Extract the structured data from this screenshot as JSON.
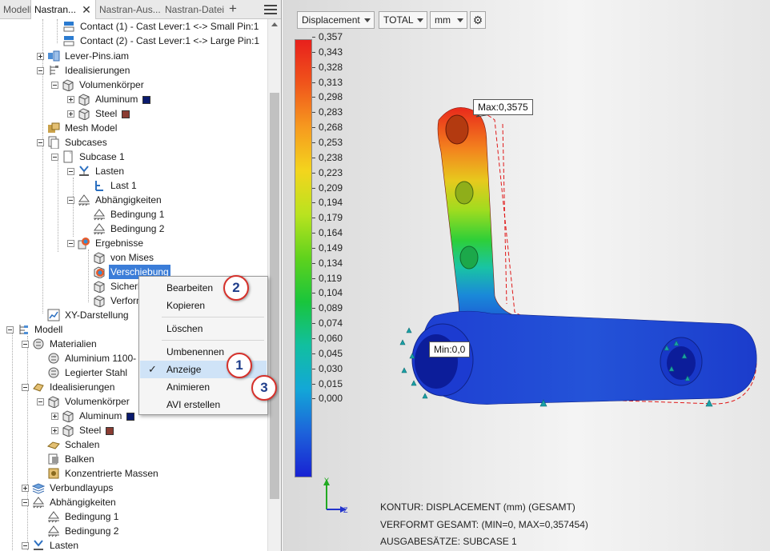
{
  "tabs": [
    {
      "label": "Modell"
    },
    {
      "label": "Nastran..."
    },
    {
      "label": "Nastran-Aus..."
    },
    {
      "label": "Nastran-Datei"
    }
  ],
  "tree": {
    "contact1": "Contact (1) - Cast Lever:1 <-> Small Pin:1",
    "contact2": "Contact (2) - Cast Lever:1 <-> Large Pin:1",
    "lever_pins": "Lever-Pins.iam",
    "idealisierungen": "Idealisierungen",
    "volumenkoerper": "Volumenkörper",
    "aluminum": "Aluminum",
    "steel": "Steel",
    "mesh_model": "Mesh Model",
    "subcases": "Subcases",
    "subcase1": "Subcase 1",
    "lasten": "Lasten",
    "last1": "Last 1",
    "abhaengigkeiten": "Abhängigkeiten",
    "bedingung1": "Bedingung 1",
    "bedingung2": "Bedingung 2",
    "ergebnisse": "Ergebnisse",
    "von_mises": "von Mises",
    "verschiebung": "Verschiebung",
    "sicherheit": "Sicherh",
    "verformt": "Verforn",
    "xy": "XY-Darstellung",
    "modell": "Modell",
    "materialien": "Materialien",
    "alu1100": "Aluminium 1100-",
    "legierter_stahl": "Legierter Stahl",
    "idealisierungen2": "Idealisierungen",
    "volumenkoerper2": "Volumenkörper",
    "aluminum2": "Aluminum",
    "steel2": "Steel",
    "schalen": "Schalen",
    "balken": "Balken",
    "konz_massen": "Konzentrierte Massen",
    "verbundlayups": "Verbundlayups",
    "abhaengigkeiten2": "Abhängigkeiten",
    "bedingung1b": "Bedingung 1",
    "bedingung2b": "Bedingung 2",
    "lasten2": "Lasten"
  },
  "colors": {
    "aluminum": "#0a1a6e",
    "steel": "#8a3c32",
    "selection": "#3b7dd8",
    "callout_border": "#d6312b"
  },
  "context_menu": {
    "bearbeiten": "Bearbeiten",
    "kopieren": "Kopieren",
    "loeschen": "Löschen",
    "umbenennen": "Umbenennen",
    "anzeige": "Anzeige",
    "animieren": "Animieren",
    "avi": "AVI erstellen"
  },
  "callouts": {
    "c1": "1",
    "c2": "2",
    "c3": "3"
  },
  "viewport": {
    "result_type": "Displacement",
    "component": "TOTAL",
    "unit": "mm",
    "max_label": "Max:0,3575",
    "min_label": "Min:0,0",
    "legend_ticks": [
      "0,357",
      "0,343",
      "0,328",
      "0,313",
      "0,298",
      "0,283",
      "0,268",
      "0,253",
      "0,238",
      "0,223",
      "0,209",
      "0,194",
      "0,179",
      "0,164",
      "0,149",
      "0,134",
      "0,119",
      "0,104",
      "0,089",
      "0,074",
      "0,060",
      "0,045",
      "0,030",
      "0,015",
      "0,000"
    ],
    "axis_y": "Y",
    "axis_z": "Z",
    "status1": "KONTUR: DISPLACEMENT (mm) (GESAMT)",
    "status2": "VERFORMT GESAMT: (MIN=0, MAX=0,357454)",
    "status3": "AUSGABESÄTZE: SUBCASE 1"
  }
}
